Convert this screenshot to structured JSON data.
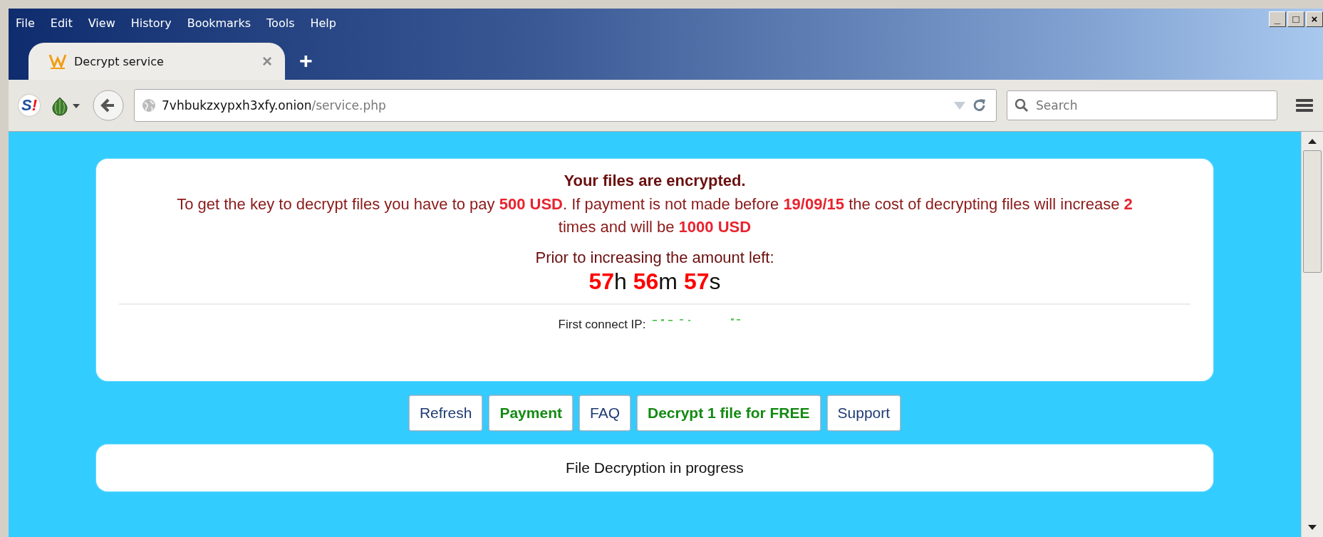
{
  "menu_bar": {
    "items": [
      "File",
      "Edit",
      "View",
      "History",
      "Bookmarks",
      "Tools",
      "Help"
    ]
  },
  "window_controls": [
    "_",
    "□",
    "×"
  ],
  "tabs": [
    {
      "title": "Decrypt service",
      "selected": true,
      "close": "×"
    }
  ],
  "new_tab": "+",
  "addon_logo": {
    "letter": "S",
    "mark": "!"
  },
  "address_bar": {
    "host": "7vhbukzxypxh3xfy.onion",
    "path": "/service.php"
  },
  "search": {
    "placeholder": "Search"
  },
  "notice": {
    "title": "Your files are encrypted.",
    "message": "To get the key to decrypt files you have to pay **500 USD**. If payment is not made before **19/09/15** the cost of decrypting files will increase **2** times and will be **1000 USD**",
    "countdown_label": "Prior to increasing the amount left:",
    "countdown": [
      {
        "value": "57",
        "unit": "h"
      },
      {
        "value": "56",
        "unit": "m"
      },
      {
        "value": "57",
        "unit": "s"
      }
    ],
    "ip_label": "First connect IP:"
  },
  "buttons": [
    {
      "label": "Refresh",
      "kind": "plain"
    },
    {
      "label": "Payment",
      "kind": "accent"
    },
    {
      "label": "FAQ",
      "kind": "plain"
    },
    {
      "label": "Decrypt 1 file for FREE",
      "kind": "accent"
    },
    {
      "label": "Support",
      "kind": "plain"
    }
  ],
  "status_panel": {
    "text": "File Decryption in progress"
  }
}
